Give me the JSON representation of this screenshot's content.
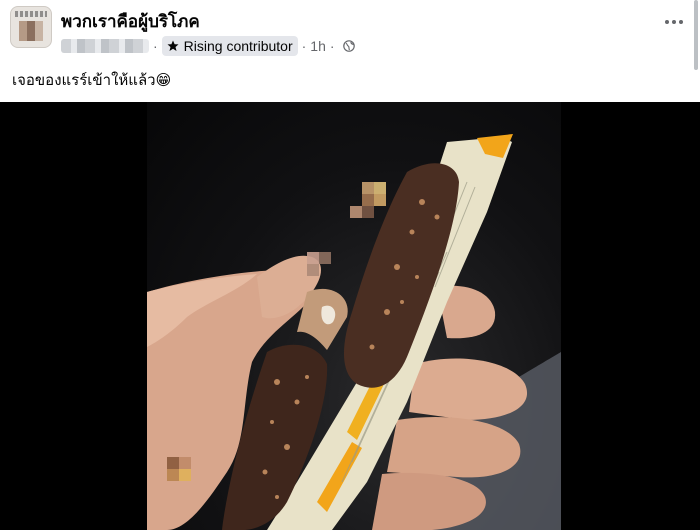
{
  "post": {
    "group_name": "พวกเราคือผู้บริโภค",
    "badge_label": "Rising contributor",
    "time": "1h",
    "separator": "·",
    "text": "เจอของแรร์เข้าให้แล้ว😁"
  },
  "icons": {
    "badge": "star-badge-icon",
    "privacy": "globe-icon",
    "more": "more-options-icon"
  },
  "colors": {
    "secondary_text": "#65676b",
    "badge_bg": "#e4e6eb",
    "photo_bg": "#000000"
  }
}
